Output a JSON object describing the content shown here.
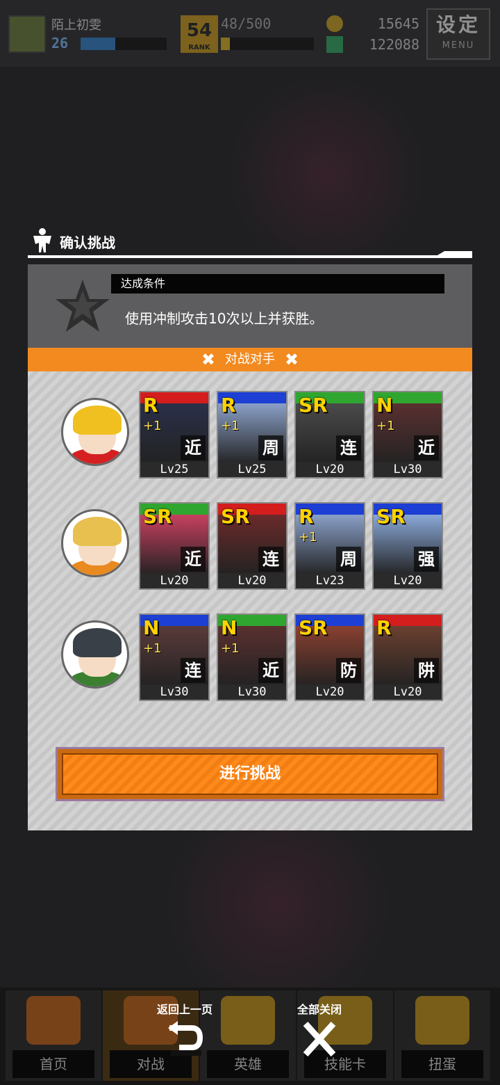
{
  "topbar": {
    "player_name": "陌上初雯",
    "level": "26",
    "exp_fraction": 0.4,
    "rank": "54",
    "rank_label": "RANK",
    "stamina": "48/500",
    "stamina_fraction": 0.096,
    "coins": "15645",
    "gems": "122088",
    "menu_label": "设定",
    "menu_sub": "MENU"
  },
  "dialog": {
    "title": "确认挑战",
    "condition_label": "达成条件",
    "condition_text": "使用冲制攻击10次以上并获胜。",
    "opponent_label": "对战对手",
    "challenge_button": "进行挑战"
  },
  "teams": [
    {
      "hair_color": "#f0c020",
      "body_color": "#d42020",
      "cards": [
        {
          "rarity": "R",
          "plus": "+1",
          "type": "近",
          "level": "Lv25",
          "frame": "#d41d1d",
          "art": "#2a2f48"
        },
        {
          "rarity": "R",
          "plus": "+1",
          "type": "周",
          "level": "Lv25",
          "frame": "#1d3fd4",
          "art": "#8aa0c8"
        },
        {
          "rarity": "SR",
          "plus": "",
          "type": "连",
          "level": "Lv20",
          "frame": "#2fa62f",
          "art": "#4a4a4a"
        },
        {
          "rarity": "N",
          "plus": "+1",
          "type": "近",
          "level": "Lv30",
          "frame": "#2fa62f",
          "art": "#5a3030"
        }
      ]
    },
    {
      "hair_color": "#e8c050",
      "body_color": "#e88a20",
      "cards": [
        {
          "rarity": "SR",
          "plus": "",
          "type": "近",
          "level": "Lv20",
          "frame": "#2fa62f",
          "art": "#c84060"
        },
        {
          "rarity": "SR",
          "plus": "",
          "type": "连",
          "level": "Lv20",
          "frame": "#d41d1d",
          "art": "#6a2a2a"
        },
        {
          "rarity": "R",
          "plus": "+1",
          "type": "周",
          "level": "Lv23",
          "frame": "#1d3fd4",
          "art": "#8aa0c8"
        },
        {
          "rarity": "SR",
          "plus": "",
          "type": "强",
          "level": "Lv20",
          "frame": "#1d3fd4",
          "art": "#8aa8d8"
        }
      ]
    },
    {
      "hair_color": "#3a4048",
      "body_color": "#3a8030",
      "cards": [
        {
          "rarity": "N",
          "plus": "+1",
          "type": "连",
          "level": "Lv30",
          "frame": "#1d3fd4",
          "art": "#5a3a3a"
        },
        {
          "rarity": "N",
          "plus": "+1",
          "type": "近",
          "level": "Lv30",
          "frame": "#2fa62f",
          "art": "#5a3030"
        },
        {
          "rarity": "SR",
          "plus": "",
          "type": "防",
          "level": "Lv20",
          "frame": "#1d3fd4",
          "art": "#8a4030"
        },
        {
          "rarity": "R",
          "plus": "",
          "type": "阱",
          "level": "Lv20",
          "frame": "#d41d1d",
          "art": "#6a4030"
        }
      ]
    }
  ],
  "bottom_nav": [
    {
      "label": "首页",
      "icon": "home-back-icon",
      "color": "#c8661a"
    },
    {
      "label": "对战",
      "icon": "gamepad-icon",
      "color": "#c8661a"
    },
    {
      "label": "英雄",
      "icon": "hero-icon",
      "color": "#c89a1a"
    },
    {
      "label": "技能卡",
      "icon": "card-icon",
      "color": "#c89a1a"
    },
    {
      "label": "扭蛋",
      "icon": "gacha-icon",
      "color": "#c89a1a"
    }
  ],
  "overlay_controls": {
    "back_label": "返回上一页",
    "close_all_label": "全部关闭"
  }
}
